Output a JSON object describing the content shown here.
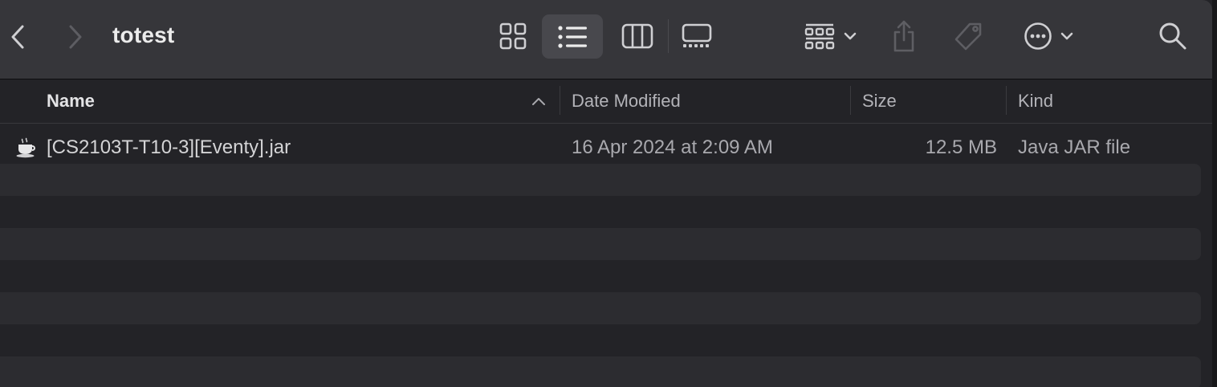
{
  "window": {
    "title": "totest"
  },
  "toolbar": {
    "back_icon": "chevron-left-icon",
    "forward_icon": "chevron-right-icon",
    "views": [
      {
        "name": "icon-view",
        "icon": "grid-icon",
        "selected": false
      },
      {
        "name": "list-view",
        "icon": "list-icon",
        "selected": true
      },
      {
        "name": "column-view",
        "icon": "columns-icon",
        "selected": false
      },
      {
        "name": "gallery-view",
        "icon": "gallery-icon",
        "selected": false
      }
    ],
    "group_icon": "group-by-icon",
    "share_icon": "share-icon",
    "tag_icon": "tag-icon",
    "more_icon": "ellipsis-circle-icon",
    "search_icon": "search-icon"
  },
  "columns": {
    "name": "Name",
    "date_modified": "Date Modified",
    "size": "Size",
    "kind": "Kind",
    "sort_indicator": "ascending"
  },
  "files": [
    {
      "name": "[CS2103T-T10-3][Eventy].jar",
      "date_modified": "16 Apr 2024 at 2:09 AM",
      "size": "12.5 MB",
      "kind": "Java JAR file",
      "icon": "java-coffee-icon"
    }
  ],
  "colors": {
    "toolbar_bg": "#36363a",
    "list_bg": "#232327",
    "stripe_bg": "#2c2c30",
    "selected_view_bg": "#48484d",
    "text_primary": "#ececec",
    "text_secondary": "#a9a9ae"
  }
}
